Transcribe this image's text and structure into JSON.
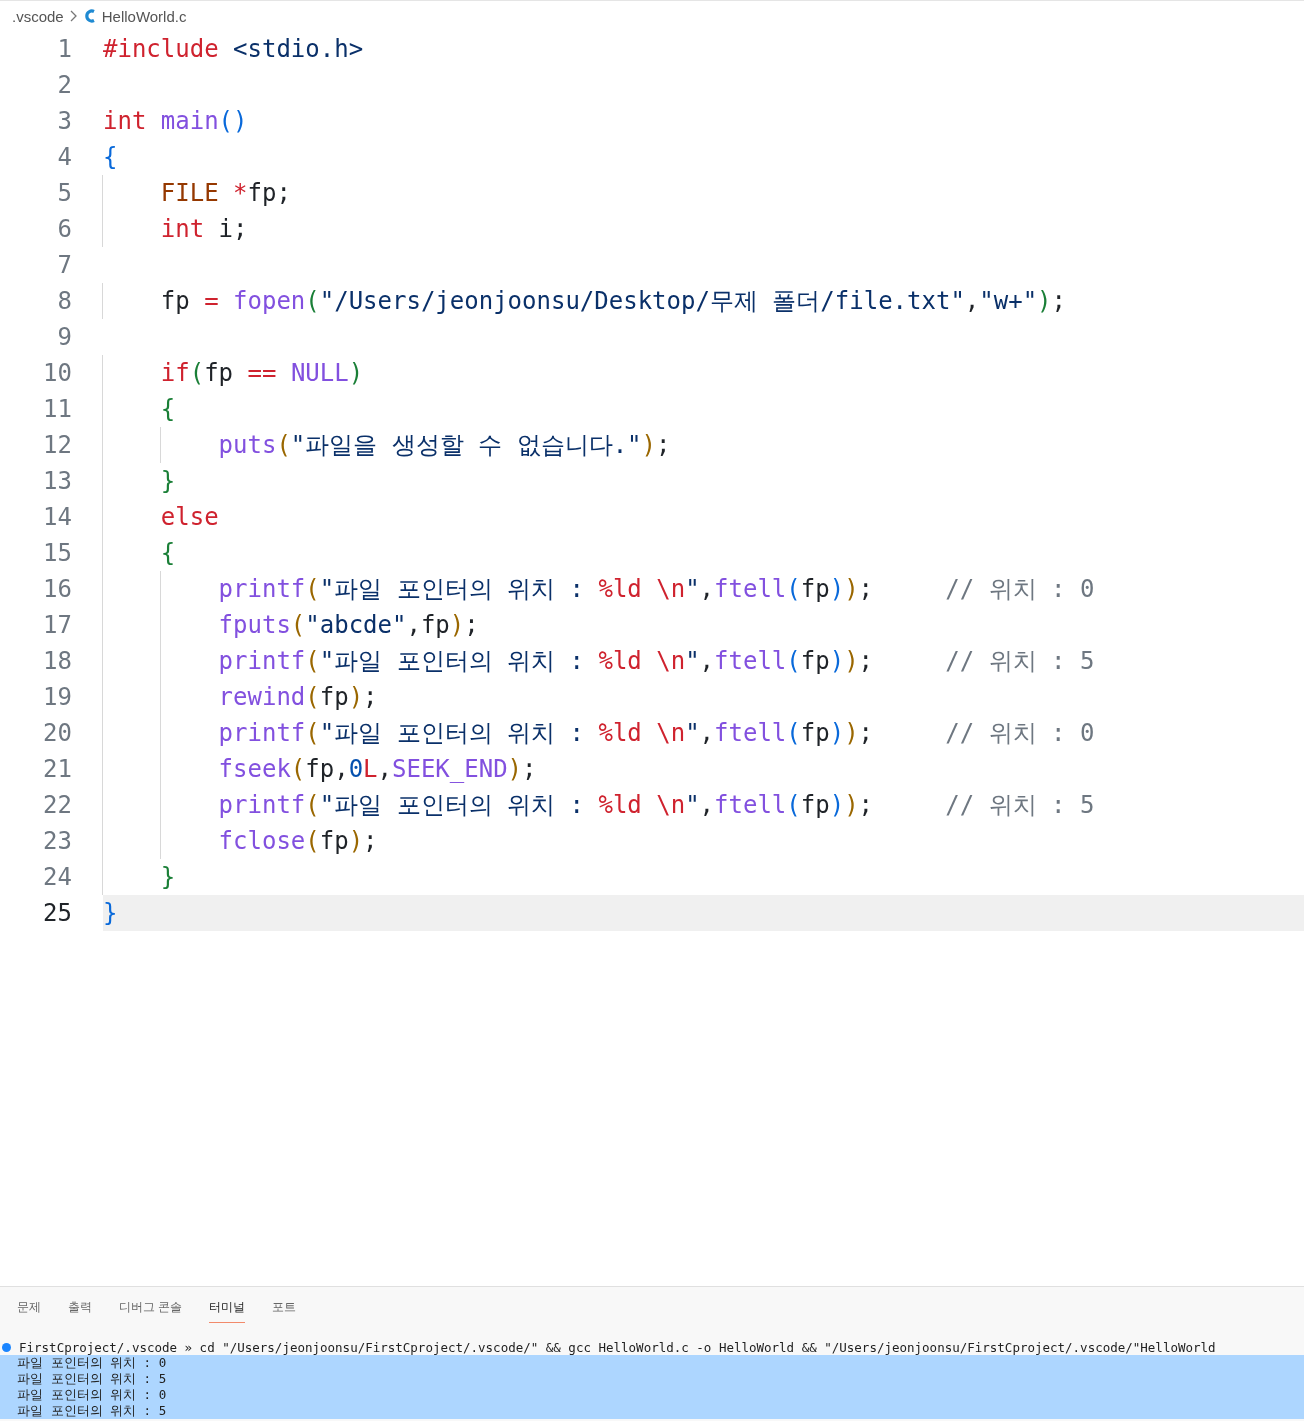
{
  "breadcrumb": {
    "folder": ".vscode",
    "file": "HelloWorld.c"
  },
  "editor": {
    "lines": [
      {
        "number": "1",
        "current": false,
        "tokens": [
          {
            "kind": "kw",
            "text": "#include "
          },
          {
            "kind": "str",
            "text": "<stdio.h>"
          }
        ]
      },
      {
        "number": "2",
        "current": false
      },
      {
        "number": "3",
        "current": false,
        "tokens": [
          {
            "kind": "kw",
            "text": "int "
          },
          {
            "kind": "fn",
            "text": "main"
          },
          {
            "kind": "p1",
            "text": "()"
          }
        ]
      },
      {
        "number": "4",
        "current": false,
        "tokens": [
          {
            "kind": "p1",
            "text": "{"
          }
        ]
      },
      {
        "number": "5",
        "current": false,
        "tokens": [
          {
            "kind": "type",
            "text": "    FILE "
          },
          {
            "kind": "op",
            "text": "*"
          },
          {
            "kind": "plain",
            "text": "fp;"
          }
        ]
      },
      {
        "number": "6",
        "current": false,
        "tokens": [
          {
            "kind": "kw",
            "text": "    int"
          },
          {
            "kind": "plain",
            "text": " i;"
          }
        ]
      },
      {
        "number": "7",
        "current": false
      },
      {
        "number": "8",
        "current": false,
        "tokens": [
          {
            "kind": "plain",
            "text": "    fp "
          },
          {
            "kind": "op",
            "text": "= "
          },
          {
            "kind": "fn",
            "text": "fopen"
          },
          {
            "kind": "p2",
            "text": "("
          },
          {
            "kind": "str",
            "text": "\"/Users/jeonjoonsu/Desktop/무제 폴더/file.txt\""
          },
          {
            "kind": "plain",
            "text": ","
          },
          {
            "kind": "str",
            "text": "\"w+\""
          },
          {
            "kind": "p2",
            "text": ")"
          },
          {
            "kind": "plain",
            "text": ";"
          }
        ]
      },
      {
        "number": "9",
        "current": false
      },
      {
        "number": "10",
        "current": false,
        "tokens": [
          {
            "kind": "kw",
            "text": "    if"
          },
          {
            "kind": "p2",
            "text": "("
          },
          {
            "kind": "plain",
            "text": "fp "
          },
          {
            "kind": "op",
            "text": "== "
          },
          {
            "kind": "fn",
            "text": "NULL"
          },
          {
            "kind": "p2",
            "text": ")"
          }
        ]
      },
      {
        "number": "11",
        "current": false,
        "tokens": [
          {
            "kind": "p2",
            "text": "    {"
          }
        ]
      },
      {
        "number": "12",
        "current": false,
        "tokens": [
          {
            "kind": "fn",
            "text": "        puts"
          },
          {
            "kind": "p3",
            "text": "("
          },
          {
            "kind": "str",
            "text": "\"파일을 생성할 수 없습니다.\""
          },
          {
            "kind": "p3",
            "text": ")"
          },
          {
            "kind": "plain",
            "text": ";"
          }
        ]
      },
      {
        "number": "13",
        "current": false,
        "tokens": [
          {
            "kind": "p2",
            "text": "    }"
          }
        ]
      },
      {
        "number": "14",
        "current": false,
        "tokens": [
          {
            "kind": "kw",
            "text": "    else"
          }
        ]
      },
      {
        "number": "15",
        "current": false,
        "tokens": [
          {
            "kind": "p2",
            "text": "    {"
          }
        ]
      },
      {
        "number": "16",
        "current": false,
        "tokens": [
          {
            "kind": "fn",
            "text": "        printf"
          },
          {
            "kind": "p3",
            "text": "("
          },
          {
            "kind": "str",
            "text": "\"파일 포인터의 위치 : "
          },
          {
            "kind": "esc",
            "text": "%ld \\n"
          },
          {
            "kind": "str",
            "text": "\""
          },
          {
            "kind": "plain",
            "text": ","
          },
          {
            "kind": "fn",
            "text": "ftell"
          },
          {
            "kind": "p1",
            "text": "("
          },
          {
            "kind": "plain",
            "text": "fp"
          },
          {
            "kind": "p1",
            "text": ")"
          },
          {
            "kind": "p3",
            "text": ")"
          },
          {
            "kind": "plain",
            "text": ";     "
          },
          {
            "kind": "cm",
            "text": "// 위치 : 0"
          }
        ]
      },
      {
        "number": "17",
        "current": false,
        "tokens": [
          {
            "kind": "fn",
            "text": "        fputs"
          },
          {
            "kind": "p3",
            "text": "("
          },
          {
            "kind": "str",
            "text": "\"abcde\""
          },
          {
            "kind": "plain",
            "text": ",fp"
          },
          {
            "kind": "p3",
            "text": ")"
          },
          {
            "kind": "plain",
            "text": ";"
          }
        ]
      },
      {
        "number": "18",
        "current": false,
        "tokens": [
          {
            "kind": "fn",
            "text": "        printf"
          },
          {
            "kind": "p3",
            "text": "("
          },
          {
            "kind": "str",
            "text": "\"파일 포인터의 위치 : "
          },
          {
            "kind": "esc",
            "text": "%ld \\n"
          },
          {
            "kind": "str",
            "text": "\""
          },
          {
            "kind": "plain",
            "text": ","
          },
          {
            "kind": "fn",
            "text": "ftell"
          },
          {
            "kind": "p1",
            "text": "("
          },
          {
            "kind": "plain",
            "text": "fp"
          },
          {
            "kind": "p1",
            "text": ")"
          },
          {
            "kind": "p3",
            "text": ")"
          },
          {
            "kind": "plain",
            "text": ";     "
          },
          {
            "kind": "cm",
            "text": "// 위치 : 5"
          }
        ]
      },
      {
        "number": "19",
        "current": false,
        "tokens": [
          {
            "kind": "fn",
            "text": "        rewind"
          },
          {
            "kind": "p3",
            "text": "("
          },
          {
            "kind": "plain",
            "text": "fp"
          },
          {
            "kind": "p3",
            "text": ")"
          },
          {
            "kind": "plain",
            "text": ";"
          }
        ]
      },
      {
        "number": "20",
        "current": false,
        "tokens": [
          {
            "kind": "fn",
            "text": "        printf"
          },
          {
            "kind": "p3",
            "text": "("
          },
          {
            "kind": "str",
            "text": "\"파일 포인터의 위치 : "
          },
          {
            "kind": "esc",
            "text": "%ld \\n"
          },
          {
            "kind": "str",
            "text": "\""
          },
          {
            "kind": "plain",
            "text": ","
          },
          {
            "kind": "fn",
            "text": "ftell"
          },
          {
            "kind": "p1",
            "text": "("
          },
          {
            "kind": "plain",
            "text": "fp"
          },
          {
            "kind": "p1",
            "text": ")"
          },
          {
            "kind": "p3",
            "text": ")"
          },
          {
            "kind": "plain",
            "text": ";     "
          },
          {
            "kind": "cm",
            "text": "// 위치 : 0"
          }
        ]
      },
      {
        "number": "21",
        "current": false,
        "tokens": [
          {
            "kind": "fn",
            "text": "        fseek"
          },
          {
            "kind": "p3",
            "text": "("
          },
          {
            "kind": "plain",
            "text": "fp,"
          },
          {
            "kind": "num",
            "text": "0"
          },
          {
            "kind": "kw",
            "text": "L"
          },
          {
            "kind": "plain",
            "text": ","
          },
          {
            "kind": "fn",
            "text": "SEEK_END"
          },
          {
            "kind": "p3",
            "text": ")"
          },
          {
            "kind": "plain",
            "text": ";"
          }
        ]
      },
      {
        "number": "22",
        "current": false,
        "tokens": [
          {
            "kind": "fn",
            "text": "        printf"
          },
          {
            "kind": "p3",
            "text": "("
          },
          {
            "kind": "str",
            "text": "\"파일 포인터의 위치 : "
          },
          {
            "kind": "esc",
            "text": "%ld \\n"
          },
          {
            "kind": "str",
            "text": "\""
          },
          {
            "kind": "plain",
            "text": ","
          },
          {
            "kind": "fn",
            "text": "ftell"
          },
          {
            "kind": "p1",
            "text": "("
          },
          {
            "kind": "plain",
            "text": "fp"
          },
          {
            "kind": "p1",
            "text": ")"
          },
          {
            "kind": "p3",
            "text": ")"
          },
          {
            "kind": "plain",
            "text": ";     "
          },
          {
            "kind": "cm",
            "text": "// 위치 : 5"
          }
        ]
      },
      {
        "number": "23",
        "current": false,
        "tokens": [
          {
            "kind": "fn",
            "text": "        fclose"
          },
          {
            "kind": "p3",
            "text": "("
          },
          {
            "kind": "plain",
            "text": "fp"
          },
          {
            "kind": "p3",
            "text": ")"
          },
          {
            "kind": "plain",
            "text": ";"
          }
        ]
      },
      {
        "number": "24",
        "current": false,
        "tokens": [
          {
            "kind": "p2",
            "text": "    }"
          }
        ]
      },
      {
        "number": "25",
        "current": true,
        "tokens": [
          {
            "kind": "p1",
            "text": "}"
          }
        ]
      }
    ]
  },
  "panel": {
    "tabs": [
      {
        "label": "문제",
        "selected": false
      },
      {
        "label": "출력",
        "selected": false
      },
      {
        "label": "디버그 콘솔",
        "selected": false
      },
      {
        "label": "터미널",
        "selected": true
      },
      {
        "label": "포트",
        "selected": false
      }
    ],
    "terminal": {
      "command": "FirstCproject/.vscode » cd \"/Users/jeonjoonsu/FirstCproject/.vscode/\" && gcc HelloWorld.c -o HelloWorld && \"/Users/jeonjoonsu/FirstCproject/.vscode/\"HelloWorld",
      "output": [
        {
          "text": "파일 포인터의 위치 : 0",
          "selected": true
        },
        {
          "text": "파일 포인터의 위치 : 5",
          "selected": true
        },
        {
          "text": "파일 포인터의 위치 : 0",
          "selected": true
        },
        {
          "text": "파일 포인터의 위치 : 5",
          "selected": true
        }
      ]
    }
  }
}
